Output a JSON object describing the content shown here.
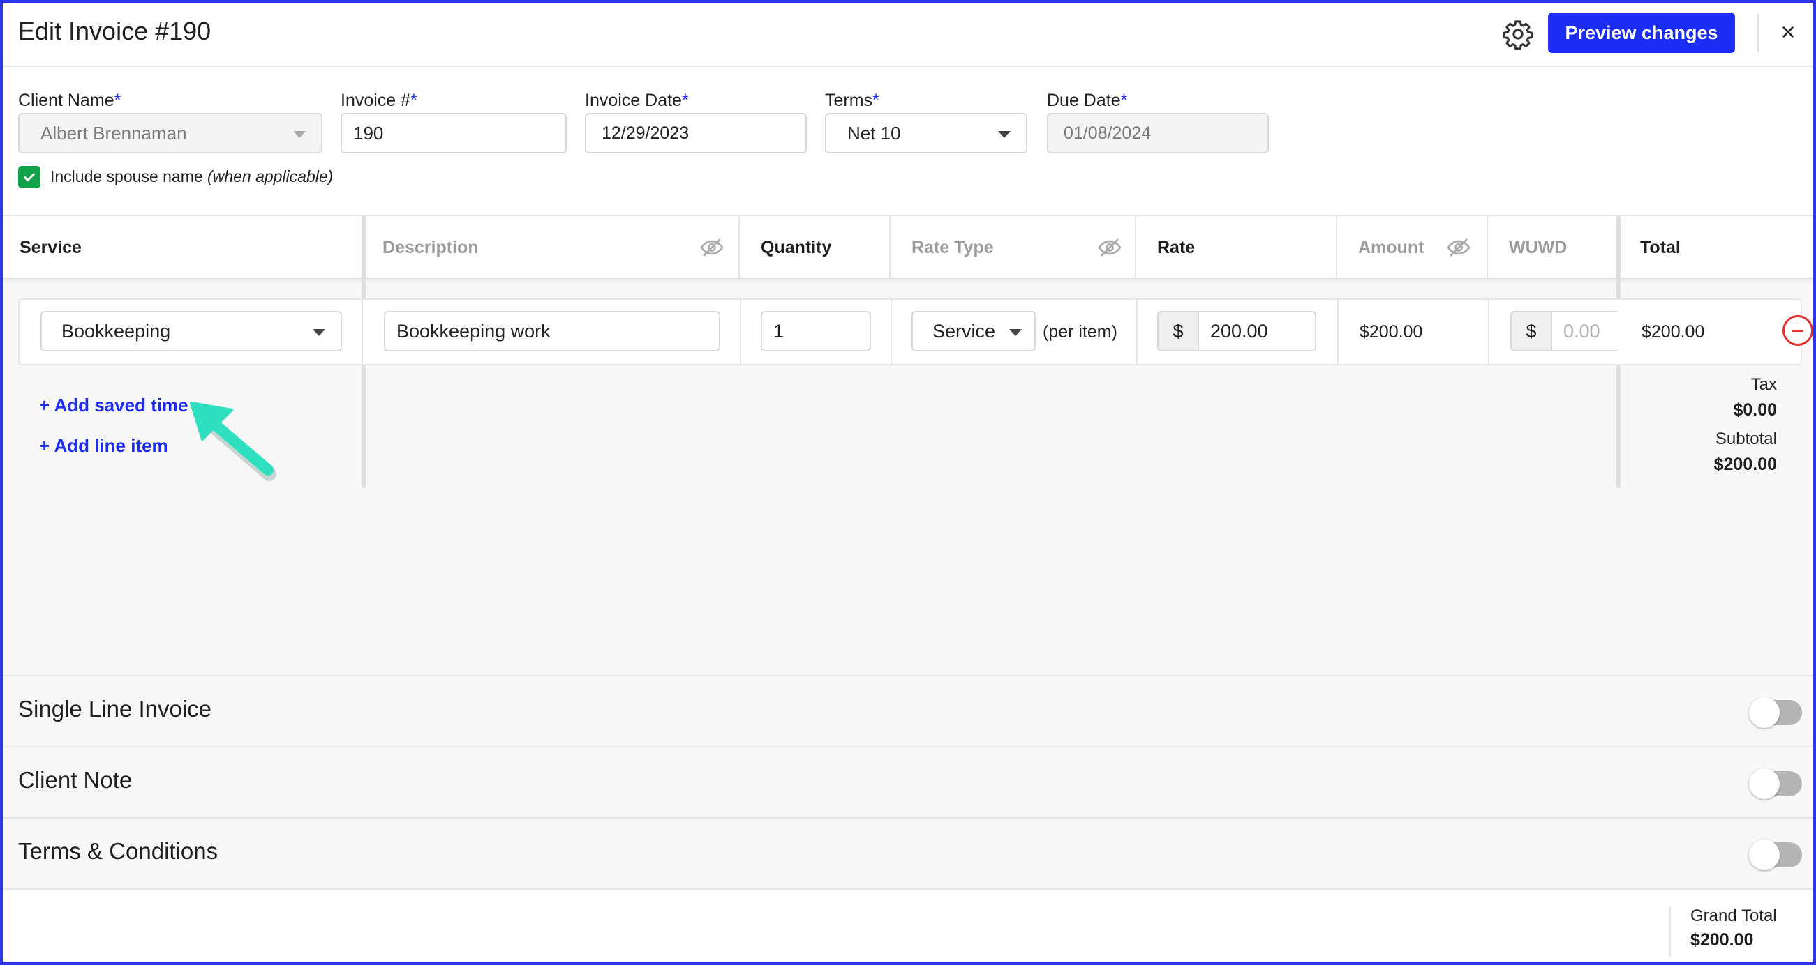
{
  "header": {
    "title": "Edit Invoice #190",
    "settings_icon": "gear-icon",
    "preview_label": "Preview changes",
    "close_icon": "close-icon",
    "close_glyph": "×"
  },
  "form": {
    "client_name": {
      "label": "Client Name",
      "required": "*",
      "value": "Albert Brennaman"
    },
    "invoice_number": {
      "label": "Invoice #",
      "required": "*",
      "value": "190"
    },
    "invoice_date": {
      "label": "Invoice Date",
      "required": "*",
      "value": "12/29/2023"
    },
    "terms": {
      "label": "Terms",
      "required": "*",
      "value": "Net 10"
    },
    "due_date": {
      "label": "Due Date",
      "required": "*",
      "value": "01/08/2024"
    },
    "include_spouse": {
      "checked": true,
      "label": "Include spouse name ",
      "note": "(when applicable)"
    }
  },
  "table": {
    "columns": {
      "service": "Service",
      "description": "Description",
      "quantity": "Quantity",
      "rate_type": "Rate Type",
      "rate": "Rate",
      "amount": "Amount",
      "wuwd": "WUWD",
      "total": "Total"
    },
    "rows": [
      {
        "service": "Bookkeeping",
        "description": "Bookkeeping work",
        "quantity": "1",
        "rate_type": "Service",
        "rate_unit": "(per item)",
        "currency": "$",
        "rate": "200.00",
        "amount": "$200.00",
        "wuwd_placeholder": "0.00",
        "total": "$200.00"
      }
    ],
    "add_saved_time": "+ Add saved time",
    "add_line_item": "+ Add line item",
    "tax_label": "Tax",
    "tax_value": "$0.00",
    "subtotal_label": "Subtotal",
    "subtotal_value": "$200.00"
  },
  "sections": [
    {
      "title": "Single Line Invoice",
      "enabled": false
    },
    {
      "title": "Client Note",
      "enabled": false
    },
    {
      "title": "Terms & Conditions",
      "enabled": false
    }
  ],
  "footer": {
    "grand_total_label": "Grand Total",
    "grand_total_value": "$200.00"
  },
  "colors": {
    "accent": "#1c2cf2",
    "check": "#13a24b",
    "remove": "#e03030",
    "annotation_arrow": "#2ee0c0"
  }
}
